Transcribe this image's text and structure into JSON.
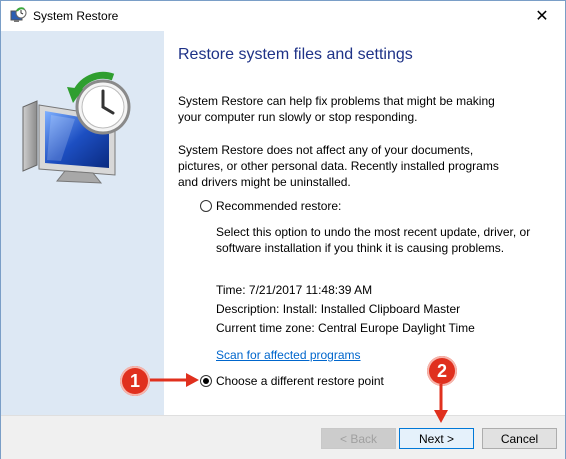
{
  "window": {
    "title": "System Restore",
    "close_glyph": "✕"
  },
  "content": {
    "heading": "Restore system files and settings",
    "paragraph1": "System Restore can help fix problems that might be making your computer run slowly or stop responding.",
    "paragraph2": "System Restore does not affect any of your documents, pictures, or other personal data. Recently installed programs and drivers might be uninstalled.",
    "recommended_label": "Recommended restore:",
    "recommended_desc": "Select this option to undo the most recent update, driver, or software installation if you think it is causing problems.",
    "time": "Time: 7/21/2017 11:48:39 AM",
    "description": "Description: Install: Installed Clipboard Master",
    "timezone": "Current time zone: Central Europe Daylight Time",
    "scan_link": "Scan for affected programs",
    "different_label": "Choose a different restore point",
    "selected_option": "Choose a different restore point"
  },
  "footer": {
    "back_label": "< Back",
    "next_label": "Next >",
    "cancel_label": "Cancel"
  },
  "annotations": {
    "badge1": "1",
    "badge2": "2",
    "color": "#e0301e"
  },
  "icons": {
    "title_icon": "system-restore-icon",
    "hero_icon": "system-restore-clock-computer-icon"
  },
  "colors": {
    "sidebar": "#dde8f4",
    "heading": "#1e3287",
    "link": "#0066cc"
  }
}
